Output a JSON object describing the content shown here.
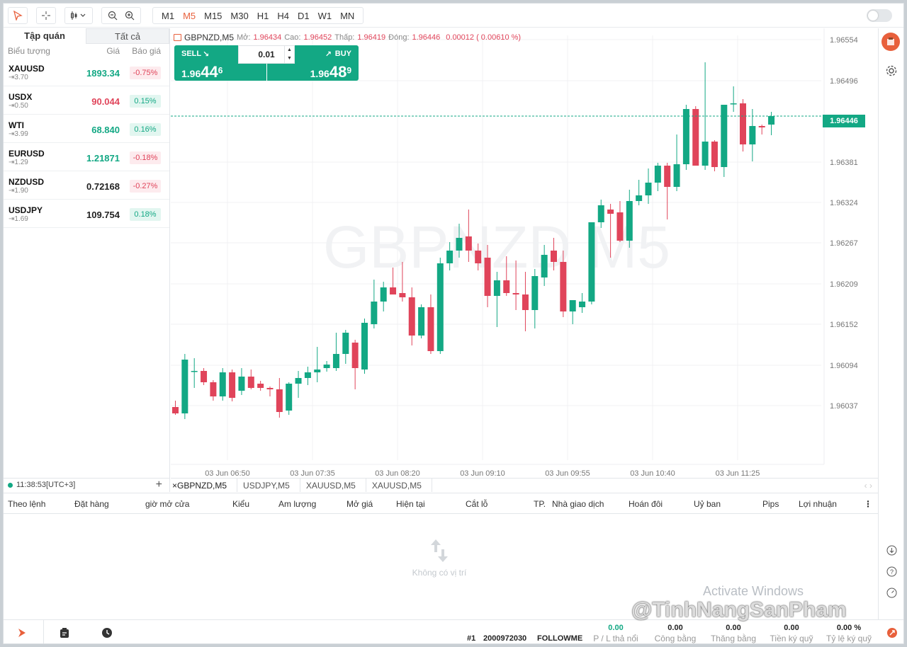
{
  "toolbar": {
    "timeframes": [
      "M1",
      "M5",
      "M15",
      "M30",
      "H1",
      "H4",
      "D1",
      "W1",
      "MN"
    ],
    "active_timeframe": "M5"
  },
  "watchlist": {
    "tabs": [
      "Tập quán",
      "Tất cả"
    ],
    "headers": {
      "symbol": "Biểu tượng",
      "price": "Giá",
      "change": "Báo giá"
    },
    "items": [
      {
        "symbol": "XAUUSD",
        "spread": "3.70",
        "price": "1893.34",
        "change": "-0.75%",
        "dir": "up",
        "chg_dir": "neg"
      },
      {
        "symbol": "USDX",
        "spread": "0.50",
        "price": "90.044",
        "change": "0.15%",
        "dir": "dn",
        "chg_dir": "pos"
      },
      {
        "symbol": "WTI",
        "spread": "3.99",
        "price": "68.840",
        "change": "0.16%",
        "dir": "up",
        "chg_dir": "pos"
      },
      {
        "symbol": "EURUSD",
        "spread": "1.29",
        "price": "1.21871",
        "change": "-0.18%",
        "dir": "up",
        "chg_dir": "neg"
      },
      {
        "symbol": "NZDUSD",
        "spread": "1.90",
        "price": "0.72168",
        "change": "-0.27%",
        "dir": "neutral",
        "chg_dir": "neg"
      },
      {
        "symbol": "USDJPY",
        "spread": "1.69",
        "price": "109.754",
        "change": "0.18%",
        "dir": "neutral",
        "chg_dir": "pos"
      }
    ],
    "clock": "11:38:53[UTC+3]"
  },
  "chart": {
    "symbol_label": "GBPNZD,M5",
    "open_label": "Mở:",
    "open": "1.96434",
    "high_label": "Cao:",
    "high": "1.96452",
    "low_label": "Thấp:",
    "low": "1.96419",
    "close_label": "Đóng:",
    "close": "1.96446",
    "change": "0.00012 ( 0.00610 %)",
    "watermark": "GBPNZD,M5",
    "current_price": "1.96446",
    "trade": {
      "sell_label": "SELL",
      "buy_label": "BUY",
      "lot": "0.01",
      "sell_prefix": "1.96",
      "sell_big": "44",
      "sell_sup": "6",
      "buy_prefix": "1.96",
      "buy_big": "48",
      "buy_sup": "9"
    },
    "tabs": [
      "GBPNZD,M5",
      "USDJPY,M5",
      "XAUUSD,M5",
      "XAUUSD,M5"
    ]
  },
  "chart_data": {
    "type": "candlestick",
    "y_ticks": [
      "1.96554",
      "1.96496",
      "1.96381",
      "1.96324",
      "1.96267",
      "1.96209",
      "1.96152",
      "1.96094",
      "1.96037"
    ],
    "x_ticks": [
      "03 Jun 06:50",
      "03 Jun 07:35",
      "03 Jun 08:20",
      "03 Jun 09:10",
      "03 Jun 09:55",
      "03 Jun 10:40",
      "03 Jun 11:25"
    ],
    "ylim": [
      1.9596,
      1.9656
    ],
    "candles": [
      [
        1.96035,
        1.96044,
        1.96024,
        1.96026
      ],
      [
        1.96026,
        1.9611,
        1.96018,
        1.96102
      ],
      [
        1.96086,
        1.96104,
        1.96062,
        1.96086
      ],
      [
        1.96086,
        1.9609,
        1.96066,
        1.9607
      ],
      [
        1.9607,
        1.96073,
        1.96044,
        1.9605
      ],
      [
        1.9605,
        1.9609,
        1.96044,
        1.96084
      ],
      [
        1.96084,
        1.96088,
        1.96043,
        1.96048
      ],
      [
        1.96058,
        1.9609,
        1.96052,
        1.96078
      ],
      [
        1.96078,
        1.96088,
        1.9606,
        1.96062
      ],
      [
        1.96068,
        1.96072,
        1.96058,
        1.96062
      ],
      [
        1.96062,
        1.96064,
        1.9605,
        1.9606
      ],
      [
        1.9606,
        1.96076,
        1.9602,
        1.96028
      ],
      [
        1.9603,
        1.9607,
        1.96024,
        1.96068
      ],
      [
        1.96068,
        1.96086,
        1.96048,
        1.96076
      ],
      [
        1.96076,
        1.96092,
        1.96066,
        1.96084
      ],
      [
        1.96084,
        1.9612,
        1.9607,
        1.96088
      ],
      [
        1.9609,
        1.961,
        1.96085,
        1.96095
      ],
      [
        1.9609,
        1.9614,
        1.96086,
        1.9611
      ],
      [
        1.9611,
        1.96144,
        1.96096,
        1.9614
      ],
      [
        1.96126,
        1.9613,
        1.9606,
        1.9609
      ],
      [
        1.96088,
        1.9616,
        1.96082,
        1.96154
      ],
      [
        1.96152,
        1.96215,
        1.96146,
        1.96184
      ],
      [
        1.96184,
        1.96212,
        1.9617,
        1.96204
      ],
      [
        1.96204,
        1.96232,
        1.96194,
        1.96194
      ],
      [
        1.96196,
        1.9624,
        1.96184,
        1.9619
      ],
      [
        1.9619,
        1.96204,
        1.96122,
        1.96136
      ],
      [
        1.96136,
        1.9618,
        1.96132,
        1.96176
      ],
      [
        1.96176,
        1.96194,
        1.9611,
        1.96114
      ],
      [
        1.96114,
        1.96246,
        1.9611,
        1.96238
      ],
      [
        1.96238,
        1.96268,
        1.96228,
        1.96256
      ],
      [
        1.96256,
        1.96294,
        1.96246,
        1.96274
      ],
      [
        1.96276,
        1.96314,
        1.9624,
        1.96256
      ],
      [
        1.96256,
        1.96266,
        1.96228,
        1.96238
      ],
      [
        1.96246,
        1.96264,
        1.96176,
        1.96192
      ],
      [
        1.96192,
        1.96226,
        1.96148,
        1.96214
      ],
      [
        1.96214,
        1.96248,
        1.96192,
        1.96196
      ],
      [
        1.96196,
        1.96242,
        1.96172,
        1.96194
      ],
      [
        1.96194,
        1.96226,
        1.96142,
        1.96172
      ],
      [
        1.96172,
        1.9623,
        1.96146,
        1.9622
      ],
      [
        1.96218,
        1.96264,
        1.96206,
        1.9625
      ],
      [
        1.96256,
        1.96274,
        1.96228,
        1.9624
      ],
      [
        1.9624,
        1.96256,
        1.96162,
        1.9617
      ],
      [
        1.9617,
        1.96186,
        1.96152,
        1.96186
      ],
      [
        1.96176,
        1.96196,
        1.96168,
        1.96184
      ],
      [
        1.96184,
        1.96296,
        1.9618,
        1.96296
      ],
      [
        1.96296,
        1.96328,
        1.96288,
        1.9632
      ],
      [
        1.96314,
        1.96322,
        1.96246,
        1.96308
      ],
      [
        1.9631,
        1.96326,
        1.96268,
        1.9627
      ],
      [
        1.9627,
        1.96342,
        1.9626,
        1.96326
      ],
      [
        1.96326,
        1.96356,
        1.9632,
        1.96334
      ],
      [
        1.96334,
        1.96372,
        1.96322,
        1.96352
      ],
      [
        1.96352,
        1.9638,
        1.9634,
        1.96376
      ],
      [
        1.96376,
        1.9638,
        1.963,
        1.96346
      ],
      [
        1.96346,
        1.9642,
        1.9634,
        1.96378
      ],
      [
        1.96378,
        1.96462,
        1.9637,
        1.96456
      ],
      [
        1.96456,
        1.9646,
        1.96376,
        1.96376
      ],
      [
        1.96376,
        1.96522,
        1.9637,
        1.9641
      ],
      [
        1.9641,
        1.96412,
        1.96368,
        1.96374
      ],
      [
        1.96374,
        1.96444,
        1.9636,
        1.96462
      ],
      [
        1.96464,
        1.96488,
        1.96452,
        1.96464
      ],
      [
        1.96464,
        1.9647,
        1.96396,
        1.96406
      ],
      [
        1.96406,
        1.96456,
        1.96382,
        1.96432
      ],
      [
        1.96432,
        1.96434,
        1.9642,
        1.9643
      ],
      [
        1.96434,
        1.96452,
        1.96419,
        1.96446
      ]
    ]
  },
  "positions": {
    "columns": [
      "Theo lệnh",
      "Đặt hàng",
      "giờ mở cửa",
      "Kiểu",
      "Am lượng",
      "Mở giá",
      "Hiện tại",
      "Cắt lỗ",
      "TP.",
      "Nhà giao dịch",
      "Hoán đôi",
      "Uỷ ban",
      "Pips",
      "Lợi nhuận"
    ],
    "empty_text": "Không có vị trí"
  },
  "bottom": {
    "account_num": "#1",
    "account_id": "2000972030",
    "account_mode": "FOLLOWME",
    "stats": [
      {
        "value": "0.00",
        "label": "P / L thả nổi"
      },
      {
        "value": "0.00",
        "label": "Công bằng"
      },
      {
        "value": "0.00",
        "label": "Thăng bằng"
      },
      {
        "value": "0.00",
        "label": "Tiền ký quỹ"
      },
      {
        "value": "0.00 %",
        "label": "Tỷ lệ ký quỹ"
      }
    ]
  },
  "overlay": {
    "activate": "Activate Windows",
    "watermark": "@TinhNangSanPham"
  },
  "colors": {
    "up": "#13a884",
    "down": "#e0445a",
    "accent": "#e8603c"
  }
}
